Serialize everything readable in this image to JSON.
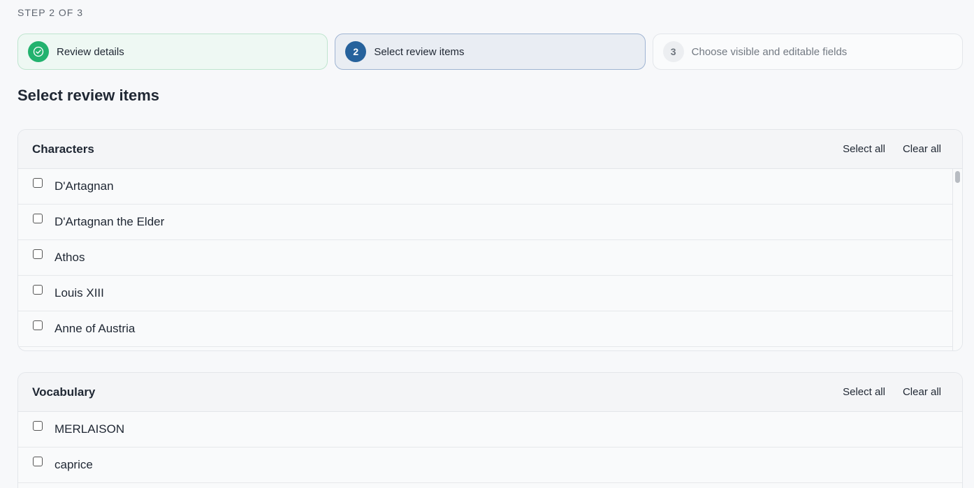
{
  "step_indicator": "STEP 2 OF 3",
  "steps": [
    {
      "number": "",
      "label": "Review details",
      "state": "done"
    },
    {
      "number": "2",
      "label": "Select review items",
      "state": "active"
    },
    {
      "number": "3",
      "label": "Choose visible and editable fields",
      "state": "todo"
    }
  ],
  "section_title": "Select review items",
  "characters": {
    "title": "Characters",
    "select_all": "Select all",
    "clear_all": "Clear all",
    "items": [
      "D'Artagnan",
      "D'Artagnan the Elder",
      "Athos",
      "Louis XIII",
      "Anne of Austria"
    ]
  },
  "vocabulary": {
    "title": "Vocabulary",
    "select_all": "Select all",
    "clear_all": "Clear all",
    "items": [
      "MERLAISON",
      "caprice"
    ]
  },
  "colors": {
    "done": "#22b26e",
    "active": "#26629c",
    "background": "#f7f8fa"
  }
}
